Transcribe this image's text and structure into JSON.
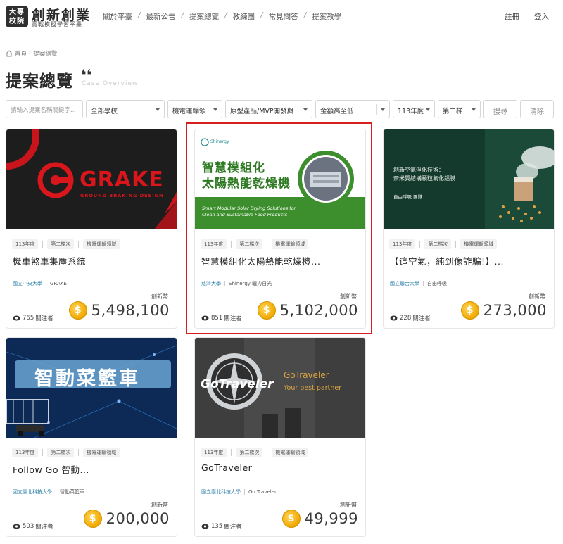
{
  "header": {
    "logo_box_line1": "大專",
    "logo_box_line2": "校院",
    "logo_title": "創新創業",
    "logo_subtitle": "實戰模擬學習平臺",
    "nav": [
      "關於平臺",
      "最新公告",
      "提案總覽",
      "教練團",
      "常見問答",
      "提案教學"
    ],
    "nav_separator": "/",
    "register": "註冊",
    "login": "登入"
  },
  "breadcrumb": {
    "home": "首頁",
    "separator": "›",
    "current": "提案總覽"
  },
  "page": {
    "title": "提案總覽",
    "quote": "❛❛",
    "title_en": "Case Overview"
  },
  "filters": {
    "search_placeholder": "請輸入提案名稱關鍵字...",
    "school": "全部學校",
    "field": "機電運輸領",
    "category": "原型產品/MVP開發與",
    "sort": "金額高至低",
    "year": "113年度",
    "round": "第二梯",
    "search_button": "搜尋",
    "clear_button": "清除"
  },
  "amount_label": "創新幣",
  "followers_suffix": "關注者",
  "cards": [
    {
      "tags": [
        "113年度",
        "第二梯次",
        "機電運輸領域"
      ],
      "title": "機車煞車集塵系統",
      "school": "國立中央大學",
      "team": "GRAKE",
      "followers": "765",
      "amount": "5,498,100",
      "img_text": "GRAKE",
      "img_subtext": "GROUND BRAKING DESIGN"
    },
    {
      "tags": [
        "113年度",
        "第二梯次",
        "機電運輸領域"
      ],
      "title": "智慧模組化太陽熱能乾燥機...",
      "school": "慈濟大學",
      "team": "Shinergy 曬力日光",
      "followers": "851",
      "amount": "5,102,000",
      "img_logo": "Shinergy",
      "img_title1": "智慧模組化",
      "img_title2": "太陽熱能乾燥機",
      "img_en1": "Smart Modular Solar Drying Solutions for",
      "img_en2": "Clean and Sustainable Food Products"
    },
    {
      "tags": [
        "113年度",
        "第二梯次",
        "機電運輸領域"
      ],
      "title": "【這空氣，純到像詐騙!】...",
      "school": "國立聯合大學",
      "team": "自由呼吸",
      "followers": "228",
      "amount": "273,000",
      "img_line1": "創新空氣淨化技術：",
      "img_line2": "奈米質結構顆粒氧化鋁膜",
      "img_line3": "自由呼吸 團隊"
    },
    {
      "tags": [
        "113年度",
        "第二梯次",
        "機電運輸領域"
      ],
      "title": "Follow Go 智動...",
      "school": "國立臺北科技大學",
      "team": "智動菜籃車",
      "followers": "503",
      "amount": "200,000",
      "img_text": "智動菜籃車"
    },
    {
      "tags": [
        "113年度",
        "第二梯次",
        "機電運輸領域"
      ],
      "title": "GoTraveler",
      "school": "國立臺北科技大學",
      "team": "Go Traveler",
      "followers": "135",
      "amount": "49,999",
      "img_logo": "GoTraveler",
      "img_title": "GoTraveler",
      "img_sub": "Your best partner"
    }
  ],
  "colors": {
    "highlight": "#d62020",
    "school_link": "#2c7fa8",
    "coin": "#f0a800"
  }
}
